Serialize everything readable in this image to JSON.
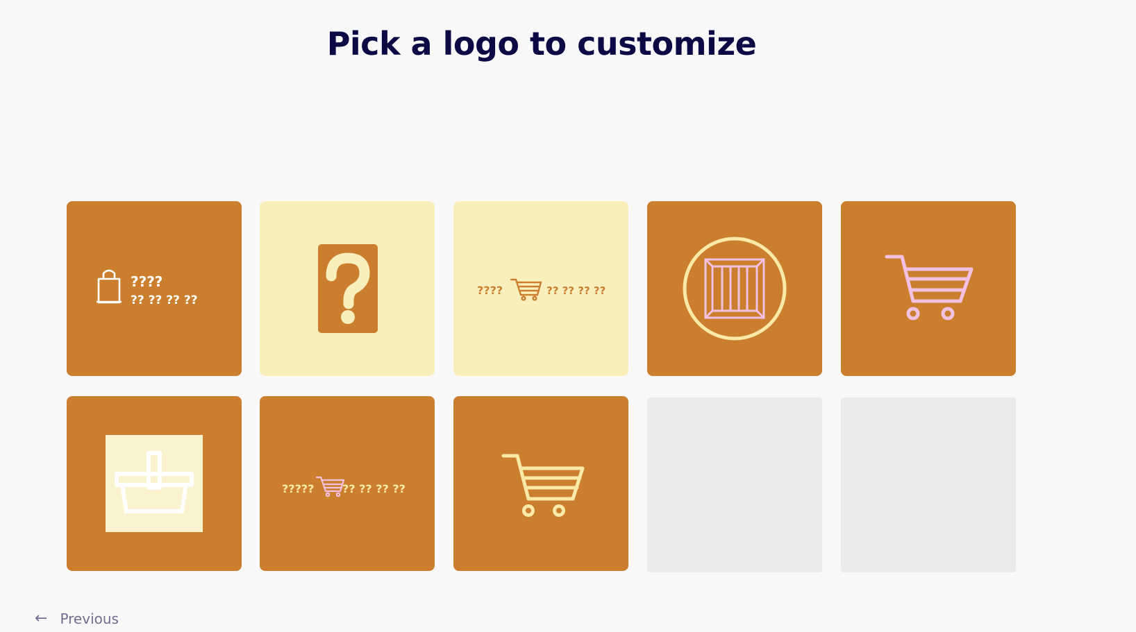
{
  "page": {
    "title": "Pick a logo to customize",
    "previous_label": "Previous"
  },
  "colors": {
    "background": "#f8f8f9",
    "title": "#0b0a45",
    "orange": "#cb7f2e",
    "cream": "#f9efbd",
    "placeholder": "#ebebeb",
    "pink": "#f2c1e2",
    "light_yellow": "#fbe9a8"
  },
  "tiles": [
    {
      "style": "orange",
      "icon": "shopping-bag-icon",
      "text_line1": "????",
      "text_line2": "?? ?? ?? ??"
    },
    {
      "style": "cream",
      "icon": "question-mark-icon"
    },
    {
      "style": "cream",
      "icon": "shopping-cart-icon",
      "text_before": "????",
      "text_after": "?? ?? ?? ??"
    },
    {
      "style": "orange",
      "icon": "crate-icon"
    },
    {
      "style": "orange",
      "icon": "shopping-cart-icon"
    },
    {
      "style": "orange",
      "icon": "basket-icon"
    },
    {
      "style": "orange",
      "icon": "shopping-cart-icon",
      "text_before": "?????",
      "text_after": "?? ?? ?? ??"
    },
    {
      "style": "orange",
      "icon": "shopping-cart-icon"
    },
    {
      "style": "placeholder"
    },
    {
      "style": "placeholder"
    }
  ]
}
